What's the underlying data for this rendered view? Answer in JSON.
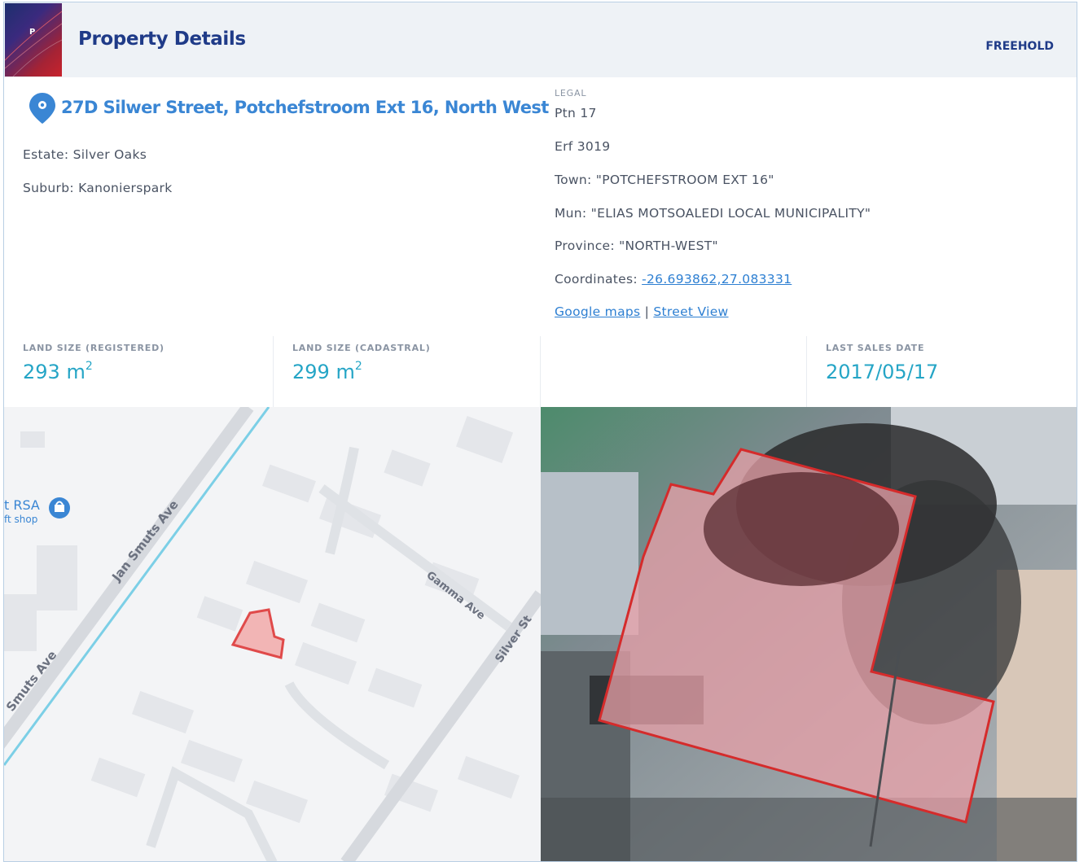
{
  "header": {
    "logo_letter": "P",
    "title": "Property Details",
    "tenure": "FREEHOLD"
  },
  "address": {
    "full": "27D Silwer Street, Potchefstroom Ext 16, North West",
    "estate": "Estate: Silver Oaks",
    "suburb": "Suburb: Kanonierspark"
  },
  "legal": {
    "label": "LEGAL",
    "portion": "Ptn 17",
    "erf": "Erf 3019",
    "town": "Town: \"POTCHEFSTROOM EXT 16\"",
    "municipality": "Mun: \"ELIAS MOTSOALEDI LOCAL MUNICIPALITY\"",
    "province": "Province: \"NORTH-WEST\"",
    "coordinates_label": "Coordinates: ",
    "coordinates_value": "-26.693862,27.083331",
    "google_maps": "Google maps",
    "separator": "|",
    "street_view": "Street View"
  },
  "stats": [
    {
      "label": "LAND SIZE (REGISTERED)",
      "value": "293 m",
      "unit_sup": "2"
    },
    {
      "label": "LAND SIZE (CADASTRAL)",
      "value": "299 m",
      "unit_sup": "2"
    },
    {
      "label": "",
      "value": "",
      "unit_sup": ""
    },
    {
      "label": "LAST SALES DATE",
      "value": "2017/05/17",
      "unit_sup": ""
    }
  ],
  "map": {
    "roads": [
      "Jan Smuts Ave",
      "Smuts Ave",
      "Gamma Ave",
      "Silver St"
    ],
    "poi_name": "t RSA",
    "poi_sub": "ft shop",
    "parcel_color": "#e04a4a"
  },
  "colors": {
    "title": "#1f3b88",
    "address": "#3a86d4",
    "stat_value": "#25a5c6",
    "link": "#2d7fd2"
  }
}
